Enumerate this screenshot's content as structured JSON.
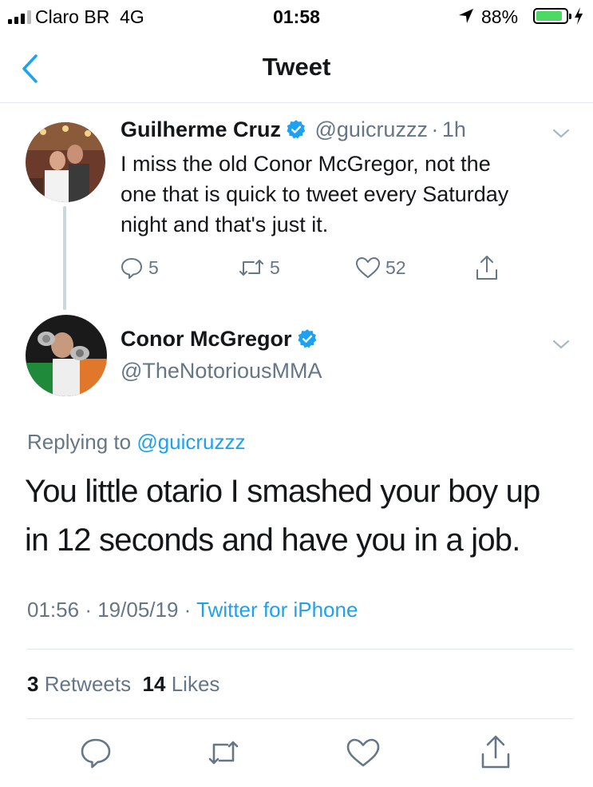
{
  "status_bar": {
    "carrier": "Claro BR",
    "network": "4G",
    "time": "01:58",
    "battery_percent": "88%",
    "battery_level": 0.88,
    "battery_color": "#4cd964"
  },
  "nav": {
    "title": "Tweet",
    "back_icon": "chevron-left-icon",
    "accent": "#1da1f2"
  },
  "parent_tweet": {
    "name": "Guilherme Cruz",
    "handle": "@guicruzzz",
    "separator": "·",
    "time_ago": "1h",
    "text_lines": [
      "I miss the old Conor McGregor, not the",
      "one that is quick to tweet every Saturday",
      "night and that's just it."
    ],
    "replies": "5",
    "retweets": "5",
    "likes": "52"
  },
  "main_tweet": {
    "name": "Conor McGregor",
    "handle": "@TheNotoriousMMA",
    "replying_prefix": "Replying to",
    "replying_handle": "@guicruzzz",
    "text_lines": [
      "You little otario I smashed your boy up",
      "in 12 seconds and have you in a job."
    ],
    "time": "01:56",
    "date": "19/05/19",
    "sep": "·",
    "source": "Twitter for iPhone",
    "retweet_count": "3",
    "retweet_label": "Retweets",
    "like_count": "14",
    "like_label": "Likes"
  },
  "colors": {
    "text": "#14171a",
    "muted": "#657786",
    "link": "#1da1f2",
    "verified": "#1da1f2",
    "divider": "#e1e8ed"
  }
}
